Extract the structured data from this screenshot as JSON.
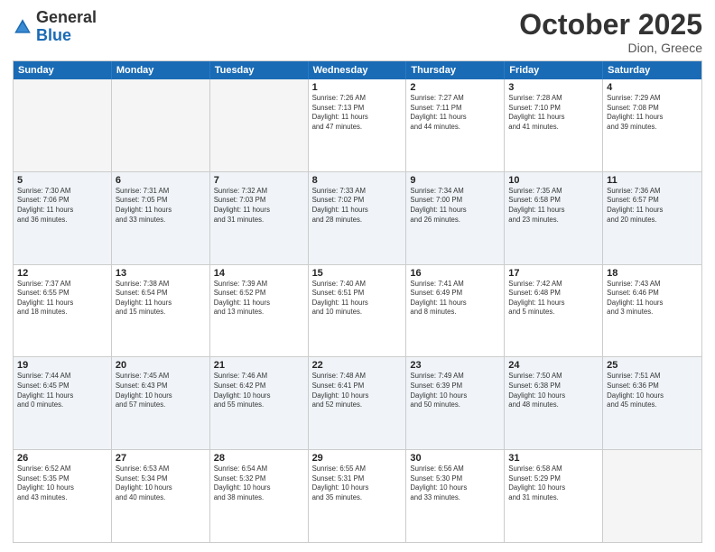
{
  "header": {
    "logo_general": "General",
    "logo_blue": "Blue",
    "month_title": "October 2025",
    "location": "Dion, Greece"
  },
  "days_of_week": [
    "Sunday",
    "Monday",
    "Tuesday",
    "Wednesday",
    "Thursday",
    "Friday",
    "Saturday"
  ],
  "rows": [
    {
      "alt": false,
      "cells": [
        {
          "day": "",
          "empty": true,
          "lines": []
        },
        {
          "day": "",
          "empty": true,
          "lines": []
        },
        {
          "day": "",
          "empty": true,
          "lines": []
        },
        {
          "day": "1",
          "empty": false,
          "lines": [
            "Sunrise: 7:26 AM",
            "Sunset: 7:13 PM",
            "Daylight: 11 hours",
            "and 47 minutes."
          ]
        },
        {
          "day": "2",
          "empty": false,
          "lines": [
            "Sunrise: 7:27 AM",
            "Sunset: 7:11 PM",
            "Daylight: 11 hours",
            "and 44 minutes."
          ]
        },
        {
          "day": "3",
          "empty": false,
          "lines": [
            "Sunrise: 7:28 AM",
            "Sunset: 7:10 PM",
            "Daylight: 11 hours",
            "and 41 minutes."
          ]
        },
        {
          "day": "4",
          "empty": false,
          "lines": [
            "Sunrise: 7:29 AM",
            "Sunset: 7:08 PM",
            "Daylight: 11 hours",
            "and 39 minutes."
          ]
        }
      ]
    },
    {
      "alt": true,
      "cells": [
        {
          "day": "5",
          "empty": false,
          "lines": [
            "Sunrise: 7:30 AM",
            "Sunset: 7:06 PM",
            "Daylight: 11 hours",
            "and 36 minutes."
          ]
        },
        {
          "day": "6",
          "empty": false,
          "lines": [
            "Sunrise: 7:31 AM",
            "Sunset: 7:05 PM",
            "Daylight: 11 hours",
            "and 33 minutes."
          ]
        },
        {
          "day": "7",
          "empty": false,
          "lines": [
            "Sunrise: 7:32 AM",
            "Sunset: 7:03 PM",
            "Daylight: 11 hours",
            "and 31 minutes."
          ]
        },
        {
          "day": "8",
          "empty": false,
          "lines": [
            "Sunrise: 7:33 AM",
            "Sunset: 7:02 PM",
            "Daylight: 11 hours",
            "and 28 minutes."
          ]
        },
        {
          "day": "9",
          "empty": false,
          "lines": [
            "Sunrise: 7:34 AM",
            "Sunset: 7:00 PM",
            "Daylight: 11 hours",
            "and 26 minutes."
          ]
        },
        {
          "day": "10",
          "empty": false,
          "lines": [
            "Sunrise: 7:35 AM",
            "Sunset: 6:58 PM",
            "Daylight: 11 hours",
            "and 23 minutes."
          ]
        },
        {
          "day": "11",
          "empty": false,
          "lines": [
            "Sunrise: 7:36 AM",
            "Sunset: 6:57 PM",
            "Daylight: 11 hours",
            "and 20 minutes."
          ]
        }
      ]
    },
    {
      "alt": false,
      "cells": [
        {
          "day": "12",
          "empty": false,
          "lines": [
            "Sunrise: 7:37 AM",
            "Sunset: 6:55 PM",
            "Daylight: 11 hours",
            "and 18 minutes."
          ]
        },
        {
          "day": "13",
          "empty": false,
          "lines": [
            "Sunrise: 7:38 AM",
            "Sunset: 6:54 PM",
            "Daylight: 11 hours",
            "and 15 minutes."
          ]
        },
        {
          "day": "14",
          "empty": false,
          "lines": [
            "Sunrise: 7:39 AM",
            "Sunset: 6:52 PM",
            "Daylight: 11 hours",
            "and 13 minutes."
          ]
        },
        {
          "day": "15",
          "empty": false,
          "lines": [
            "Sunrise: 7:40 AM",
            "Sunset: 6:51 PM",
            "Daylight: 11 hours",
            "and 10 minutes."
          ]
        },
        {
          "day": "16",
          "empty": false,
          "lines": [
            "Sunrise: 7:41 AM",
            "Sunset: 6:49 PM",
            "Daylight: 11 hours",
            "and 8 minutes."
          ]
        },
        {
          "day": "17",
          "empty": false,
          "lines": [
            "Sunrise: 7:42 AM",
            "Sunset: 6:48 PM",
            "Daylight: 11 hours",
            "and 5 minutes."
          ]
        },
        {
          "day": "18",
          "empty": false,
          "lines": [
            "Sunrise: 7:43 AM",
            "Sunset: 6:46 PM",
            "Daylight: 11 hours",
            "and 3 minutes."
          ]
        }
      ]
    },
    {
      "alt": true,
      "cells": [
        {
          "day": "19",
          "empty": false,
          "lines": [
            "Sunrise: 7:44 AM",
            "Sunset: 6:45 PM",
            "Daylight: 11 hours",
            "and 0 minutes."
          ]
        },
        {
          "day": "20",
          "empty": false,
          "lines": [
            "Sunrise: 7:45 AM",
            "Sunset: 6:43 PM",
            "Daylight: 10 hours",
            "and 57 minutes."
          ]
        },
        {
          "day": "21",
          "empty": false,
          "lines": [
            "Sunrise: 7:46 AM",
            "Sunset: 6:42 PM",
            "Daylight: 10 hours",
            "and 55 minutes."
          ]
        },
        {
          "day": "22",
          "empty": false,
          "lines": [
            "Sunrise: 7:48 AM",
            "Sunset: 6:41 PM",
            "Daylight: 10 hours",
            "and 52 minutes."
          ]
        },
        {
          "day": "23",
          "empty": false,
          "lines": [
            "Sunrise: 7:49 AM",
            "Sunset: 6:39 PM",
            "Daylight: 10 hours",
            "and 50 minutes."
          ]
        },
        {
          "day": "24",
          "empty": false,
          "lines": [
            "Sunrise: 7:50 AM",
            "Sunset: 6:38 PM",
            "Daylight: 10 hours",
            "and 48 minutes."
          ]
        },
        {
          "day": "25",
          "empty": false,
          "lines": [
            "Sunrise: 7:51 AM",
            "Sunset: 6:36 PM",
            "Daylight: 10 hours",
            "and 45 minutes."
          ]
        }
      ]
    },
    {
      "alt": false,
      "cells": [
        {
          "day": "26",
          "empty": false,
          "lines": [
            "Sunrise: 6:52 AM",
            "Sunset: 5:35 PM",
            "Daylight: 10 hours",
            "and 43 minutes."
          ]
        },
        {
          "day": "27",
          "empty": false,
          "lines": [
            "Sunrise: 6:53 AM",
            "Sunset: 5:34 PM",
            "Daylight: 10 hours",
            "and 40 minutes."
          ]
        },
        {
          "day": "28",
          "empty": false,
          "lines": [
            "Sunrise: 6:54 AM",
            "Sunset: 5:32 PM",
            "Daylight: 10 hours",
            "and 38 minutes."
          ]
        },
        {
          "day": "29",
          "empty": false,
          "lines": [
            "Sunrise: 6:55 AM",
            "Sunset: 5:31 PM",
            "Daylight: 10 hours",
            "and 35 minutes."
          ]
        },
        {
          "day": "30",
          "empty": false,
          "lines": [
            "Sunrise: 6:56 AM",
            "Sunset: 5:30 PM",
            "Daylight: 10 hours",
            "and 33 minutes."
          ]
        },
        {
          "day": "31",
          "empty": false,
          "lines": [
            "Sunrise: 6:58 AM",
            "Sunset: 5:29 PM",
            "Daylight: 10 hours",
            "and 31 minutes."
          ]
        },
        {
          "day": "",
          "empty": true,
          "lines": []
        }
      ]
    }
  ]
}
